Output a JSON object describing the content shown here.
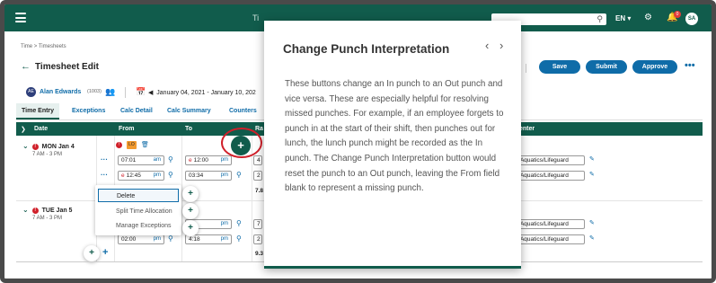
{
  "topbar": {
    "title": "Ti",
    "lang": "EN",
    "notification_count": "0",
    "user_initials": "SA"
  },
  "breadcrumb": "Time > Timesheets",
  "page_title": "Timesheet Edit",
  "actions": {
    "save": "Save",
    "submit": "Submit",
    "approve": "Approve",
    "more": "•••"
  },
  "user": {
    "initials": "AE",
    "name": "Alan Edwards",
    "id": "(1003)"
  },
  "date_range": "January 04, 2021 - January 10, 202",
  "tabs": [
    "Time Entry",
    "Exceptions",
    "Calc Detail",
    "Calc Summary",
    "Counters"
  ],
  "table": {
    "headers": {
      "date": "Date",
      "from": "From",
      "to": "To",
      "ra": "Ra",
      "center": "enter"
    }
  },
  "rows": {
    "mon": {
      "label": "MON Jan 4",
      "shift": "7 AM - 3 PM",
      "badge": "LO"
    },
    "tue": {
      "label": "TUE Jan 5",
      "shift": "7 AM - 3 PM"
    }
  },
  "punches": {
    "mon_in_time": "07:01",
    "mon_in_ampm": "am",
    "mon_out_time": "12:00",
    "mon_out_ampm": "pm",
    "mon2_in_time": "12:45",
    "mon2_in_ampm": "pm",
    "mon2_out_time": "03:34",
    "mon2_out_ampm": "pm",
    "tue_out1_ampm": "pm",
    "tue2_in_time": "02:00",
    "tue2_in_ampm": "pm",
    "tue2_out_time": "4:18",
    "tue2_out_ampm": "pm"
  },
  "cost_center": "r/Aquatics/Lifeguard",
  "numbers": {
    "mon_a": "4",
    "mon_b": "2",
    "mon_total": "7.8",
    "tue_a": "7",
    "tue_b": "2",
    "tue_total": "9.3"
  },
  "context_menu": {
    "delete": "Delete",
    "split": "Split Time Allocation",
    "manage": "Manage Exceptions"
  },
  "popup": {
    "title": "Change Punch Interpretation",
    "prev": "‹",
    "next": "›",
    "body": "These buttons change an In punch to an Out punch and vice versa. These are especially helpful for resolving missed punches. For example, if an employee forgets to punch in at the start of their shift, then punches out for lunch, the lunch punch might be recorded as the In punch. The Change Punch Interpretation button would reset the punch to an Out punch, leaving the From field blank to represent a missing punch."
  },
  "colors": {
    "brand_green": "#115c4c",
    "action_blue": "#0f6ca8",
    "error_red": "#d0202a",
    "warning_orange": "#f29a2e"
  }
}
